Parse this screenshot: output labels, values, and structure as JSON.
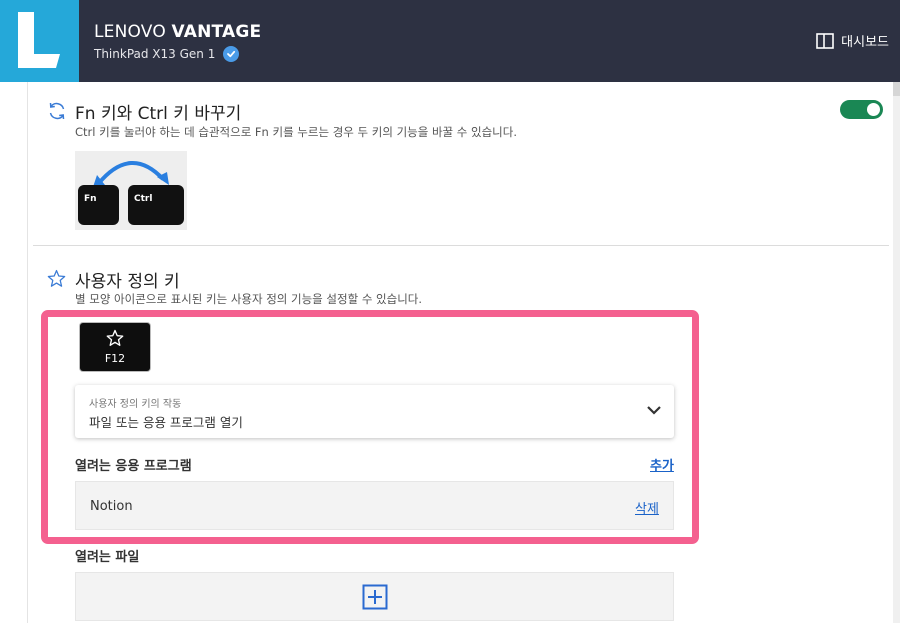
{
  "header": {
    "app_title_prefix": "LENOVO",
    "app_title_bold": "VANTAGE",
    "device_name": "ThinkPad X13 Gen 1",
    "dashboard_label": "대시보드",
    "logo_letter": "L"
  },
  "fn_ctrl_section": {
    "title": "Fn 키와 Ctrl 키 바꾸기",
    "description": "Ctrl 키를 눌러야 하는 데 습관적으로 Fn 키를 누르는 경우 두 키의 기능을 바꿀 수 있습니다.",
    "toggle_on": true,
    "key_left": "Fn",
    "key_right": "Ctrl"
  },
  "custom_key_section": {
    "title": "사용자 정의 키",
    "description": "별 모양 아이콘으로 표시된 키는 사용자 정의 기능을 설정할 수 있습니다.",
    "key_label": "F12",
    "dropdown": {
      "label": "사용자 정의 키의 작동",
      "value": "파일 또는 응용 프로그램 열기"
    },
    "apps_title": "열려는 응용 프로그램",
    "add_label": "추가",
    "apps": [
      {
        "name": "Notion",
        "delete_label": "삭제"
      }
    ],
    "files_title": "열려는 파일"
  },
  "colors": {
    "header_bg": "#2d3142",
    "logo_bg": "#25a8d9",
    "toggle_on": "#1a8754",
    "link": "#1a62c8",
    "highlight": "#f4608f"
  },
  "icons": {
    "sync": "sync-icon",
    "star": "star-icon",
    "dashboard": "dashboard-icon",
    "verified": "checkmark-icon",
    "chevron": "chevron-down-icon",
    "add": "plus-icon"
  }
}
